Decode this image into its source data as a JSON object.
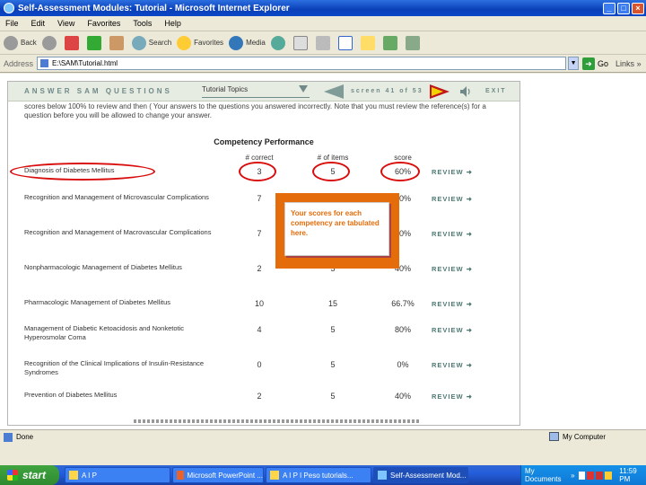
{
  "window": {
    "title": "Self-Assessment Modules: Tutorial - Microsoft Internet Explorer"
  },
  "menu": [
    "File",
    "Edit",
    "View",
    "Favorites",
    "Tools",
    "Help"
  ],
  "toolbar": {
    "back": "Back",
    "search": "Search",
    "favorites": "Favorites",
    "media": "Media"
  },
  "address": {
    "label": "Address",
    "value": "E:\\SAM\\Tutorial.html",
    "go": "Go",
    "links": "Links",
    "more": "»"
  },
  "sam": {
    "header_title": "ANSWER SAM QUESTIONS",
    "topics_select": "Tutorial Topics",
    "screen": "screen 41 of 53",
    "exit": "EXIT",
    "instructions": "scores below 100% to review and then ( Your answers to the questions you answered incorrectly. Note that you must review the reference(s) for a question before you will be allowed to change your answer.",
    "heading": "Competency Performance",
    "col_correct": "# correct",
    "col_total": "# of items",
    "col_score": "score",
    "review_label": "REVIEW",
    "rows": [
      {
        "name": "Diagnosis of Diabetes Mellitus",
        "correct": "3",
        "total": "5",
        "score": "60%"
      },
      {
        "name": "Recognition and Management of Microvascular Complications",
        "correct": "7",
        "total": "",
        "score": "70%"
      },
      {
        "name": "Recognition and Management of Macrovascular Complications",
        "correct": "7",
        "total": "",
        "score": "70%"
      },
      {
        "name": "Nonpharmacologic Management of Diabetes Mellitus",
        "correct": "2",
        "total": "5",
        "score": "40%"
      },
      {
        "name": "Pharmacologic Management of Diabetes Mellitus",
        "correct": "10",
        "total": "15",
        "score": "66.7%"
      },
      {
        "name": "Management of Diabetic Ketoacidosis and Nonketotic Hyperosmolar Coma",
        "correct": "4",
        "total": "5",
        "score": "80%"
      },
      {
        "name": "Recognition of the Clinical Implications of Insulin-Resistance Syndromes",
        "correct": "0",
        "total": "5",
        "score": "0%"
      },
      {
        "name": "Prevention of Diabetes Mellitus",
        "correct": "2",
        "total": "5",
        "score": "40%"
      }
    ],
    "callout": "Your scores for each competency are tabulated here."
  },
  "status": {
    "left": "Done",
    "right": "My Computer"
  },
  "taskbar": {
    "start": "start",
    "tasks": [
      "A I P",
      "Microsoft PowerPoint ...",
      "A I P I Peso tutorials...",
      "Self-Assessment Mod..."
    ],
    "tray_docs": "My Documents",
    "clock": "11:59 PM"
  },
  "colors": {
    "accent_red": "#d90c0c",
    "callout_orange": "#e46c0a",
    "sam_teal": "#6f8a89"
  }
}
